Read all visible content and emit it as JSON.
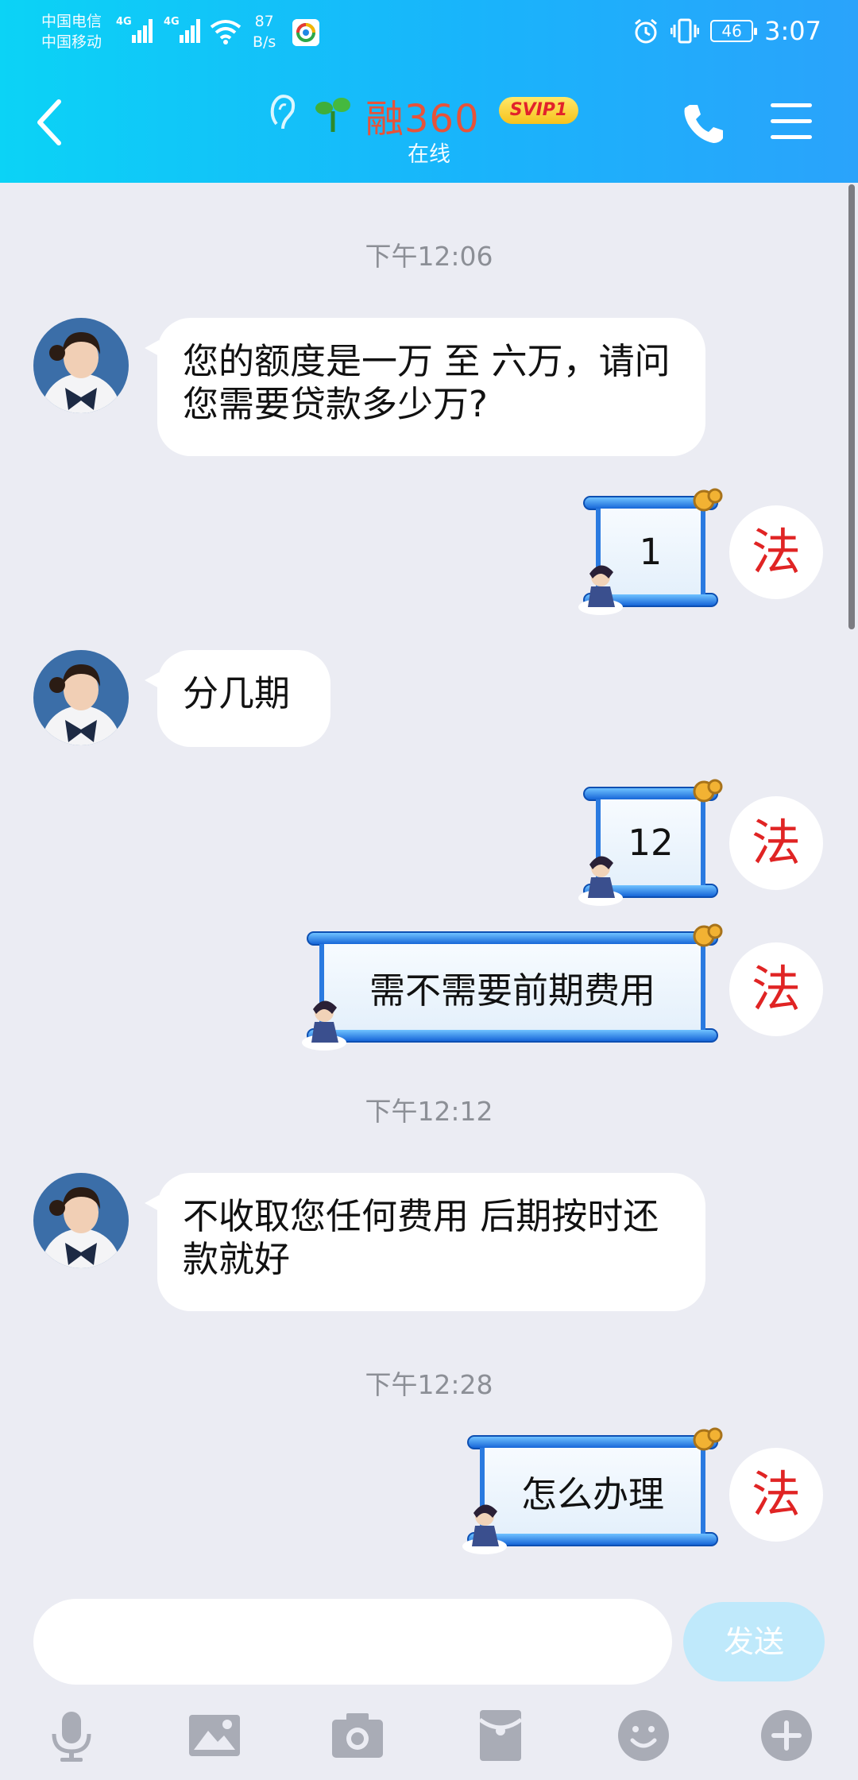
{
  "status_bar": {
    "carrier_1": "中国电信",
    "carrier_2": "中国移动",
    "net_1": "4G",
    "net_2": "4G",
    "speed_value": "87",
    "speed_unit": "B/s",
    "battery": "46",
    "time": "3:07"
  },
  "header": {
    "title": "融360",
    "badge": "SVIP1",
    "status": "在线",
    "title_color": "#e6533a",
    "accent_color": "#19b4fb"
  },
  "messages": {
    "time_1": "下午12:06",
    "msg_1": "您的额度是一万 至 六万，请问您需要贷款多少万?",
    "reply_1": "1",
    "msg_2": "分几期",
    "reply_2": "12",
    "reply_3": "需不需要前期费用",
    "time_2": "下午12:12",
    "msg_3": "不收取您任何费用 后期按时还款就好",
    "time_3": "下午12:28",
    "reply_4": "怎么办理",
    "my_avatar_char": "法"
  },
  "input": {
    "placeholder": "",
    "send_label": "发送"
  },
  "toolbar": {
    "icons": [
      "microphone-icon",
      "image-icon",
      "camera-icon",
      "red-packet-icon",
      "emoji-icon",
      "plus-icon"
    ]
  }
}
